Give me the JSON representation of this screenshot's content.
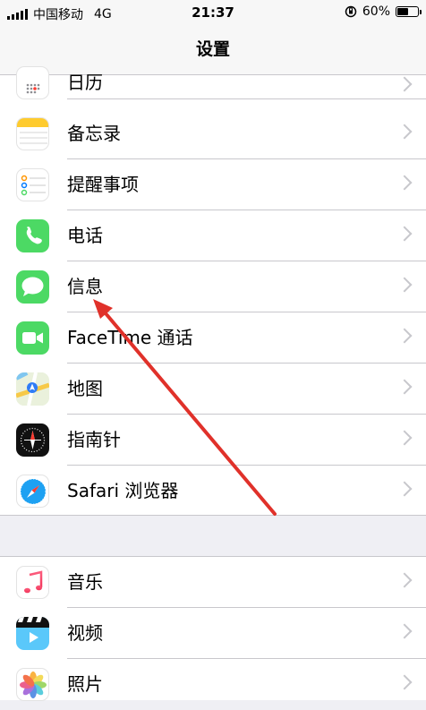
{
  "status": {
    "carrier": "中国移动",
    "network": "4G",
    "time": "21:37",
    "battery": "60%",
    "battery_level": 0.6
  },
  "nav": {
    "title": "设置"
  },
  "apps_top": [
    {
      "label": "日历",
      "icon": "calendar-icon"
    },
    {
      "label": "备忘录",
      "icon": "notes-icon"
    },
    {
      "label": "提醒事项",
      "icon": "reminders-icon"
    },
    {
      "label": "电话",
      "icon": "phone-icon"
    },
    {
      "label": "信息",
      "icon": "messages-icon"
    },
    {
      "label": "FaceTime 通话",
      "icon": "facetime-icon"
    },
    {
      "label": "地图",
      "icon": "maps-icon"
    },
    {
      "label": "指南针",
      "icon": "compass-icon"
    },
    {
      "label": "Safari 浏览器",
      "icon": "safari-icon"
    }
  ],
  "apps_bottom": [
    {
      "label": "音乐",
      "icon": "music-icon"
    },
    {
      "label": "视频",
      "icon": "videos-icon"
    },
    {
      "label": "照片",
      "icon": "photos-icon"
    }
  ],
  "colors": {
    "accent_arrow": "#e0312a",
    "green": "#4cd964"
  }
}
